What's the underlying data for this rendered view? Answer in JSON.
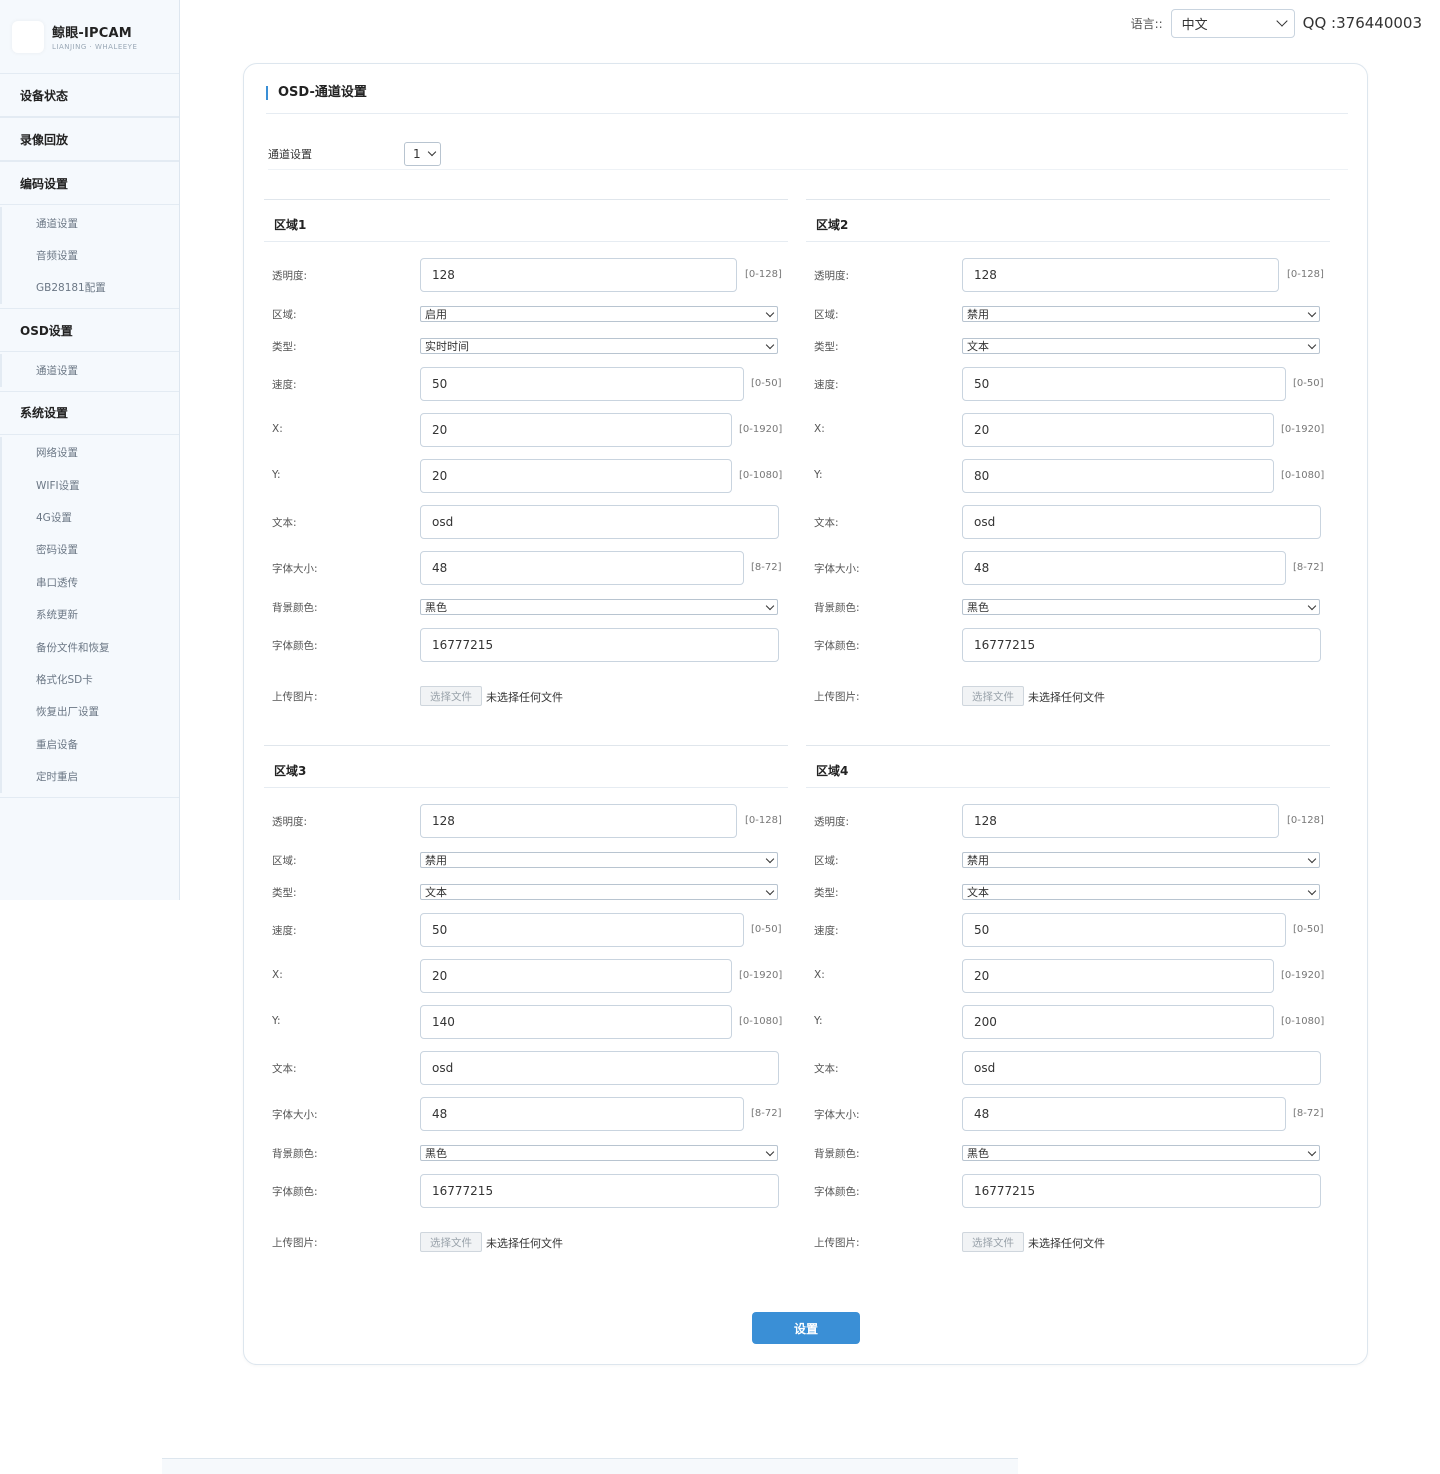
{
  "logo": {
    "title": "鲸眼-IPCAM",
    "subtitle": "LIANJING · WHALEEYE"
  },
  "sidebar": {
    "groups": [
      {
        "label": "设备状态",
        "items": []
      },
      {
        "label": "录像回放",
        "items": []
      },
      {
        "label": "编码设置",
        "items": [
          "通道设置",
          "音频设置",
          "GB28181配置"
        ]
      },
      {
        "label": "OSD设置",
        "items": [
          "通道设置"
        ]
      },
      {
        "label": "系统设置",
        "items": [
          "网络设置",
          "WIFI设置",
          "4G设置",
          "密码设置",
          "串口透传",
          "系统更新",
          "备份文件和恢复",
          "格式化SD卡",
          "恢复出厂设置",
          "重启设备",
          "定时重启"
        ]
      }
    ]
  },
  "topbar": {
    "language_label": "语言::",
    "language_value": "中文",
    "qq": "QQ :376440003"
  },
  "panel": {
    "title": "OSD-通道设置",
    "channel_label": "通道设置",
    "channel_value": "1",
    "submit_label": "设置"
  },
  "labels": {
    "opacity": "透明度:",
    "area": "区域:",
    "type": "类型:",
    "speed": "速度:",
    "x": "X:",
    "y": "Y:",
    "text": "文本:",
    "font_size": "字体大小:",
    "bg_color": "背景颜色:",
    "font_color": "字体颜色:",
    "upload": "上传图片:",
    "file_button": "选择文件",
    "file_none": "未选择任何文件"
  },
  "ranges": {
    "opacity": "[0-128]",
    "speed": "[0-50]",
    "x": "[0-1920]",
    "y": "[0-1080]",
    "font_size": "[8-72]"
  },
  "regions": [
    {
      "title": "区域1",
      "opacity": "128",
      "area": "启用",
      "type": "实时时间",
      "speed": "50",
      "x": "20",
      "y": "20",
      "text": "osd",
      "font_size": "48",
      "bg_color": "黑色",
      "font_color": "16777215"
    },
    {
      "title": "区域2",
      "opacity": "128",
      "area": "禁用",
      "type": "文本",
      "speed": "50",
      "x": "20",
      "y": "80",
      "text": "osd",
      "font_size": "48",
      "bg_color": "黑色",
      "font_color": "16777215"
    },
    {
      "title": "区域3",
      "opacity": "128",
      "area": "禁用",
      "type": "文本",
      "speed": "50",
      "x": "20",
      "y": "140",
      "text": "osd",
      "font_size": "48",
      "bg_color": "黑色",
      "font_color": "16777215"
    },
    {
      "title": "区域4",
      "opacity": "128",
      "area": "禁用",
      "type": "文本",
      "speed": "50",
      "x": "20",
      "y": "200",
      "text": "osd",
      "font_size": "48",
      "bg_color": "黑色",
      "font_color": "16777215"
    }
  ],
  "colors": {
    "accent": "#3a8fd6",
    "sidebar_bg": "#f5f9fd"
  }
}
